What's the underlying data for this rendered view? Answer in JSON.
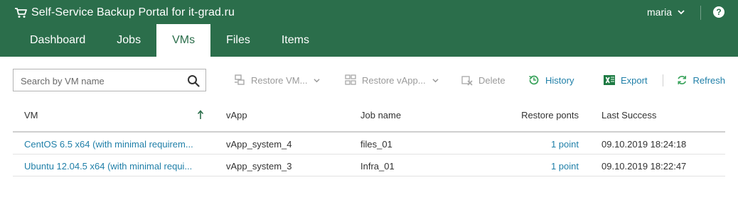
{
  "app": {
    "title": "Self-Service Backup Portal for it-grad.ru"
  },
  "user": {
    "name": "maria"
  },
  "tabs": [
    {
      "label": "Dashboard"
    },
    {
      "label": "Jobs"
    },
    {
      "label": "VMs"
    },
    {
      "label": "Files"
    },
    {
      "label": "Items"
    }
  ],
  "active_tab": "VMs",
  "search": {
    "placeholder": "Search by VM name",
    "value": ""
  },
  "toolbar": {
    "restore_vm": "Restore VM...",
    "restore_vapp": "Restore vApp...",
    "delete": "Delete",
    "history": "History",
    "export": "Export",
    "refresh": "Refresh"
  },
  "columns": {
    "vm": "VM",
    "vapp": "vApp",
    "job_name": "Job name",
    "restore_points": "Restore ponts",
    "last_success": "Last Success"
  },
  "sort": {
    "column": "VM",
    "direction": "ascending"
  },
  "rows": [
    {
      "vm": "CentOS 6.5 x64 (with minimal requirem...",
      "vapp": "vApp_system_4",
      "job": "files_01",
      "points": "1 point",
      "last_success": "09.10.2019 18:24:18"
    },
    {
      "vm": "Ubuntu 12.04.5 x64 (with minimal requi...",
      "vapp": "vApp_system_3",
      "job": "Infra_01",
      "points": "1 point",
      "last_success": "09.10.2019 18:22:47"
    }
  ],
  "colors": {
    "header_bg": "#2b6e4b",
    "link": "#1f7fa8",
    "disabled": "#9a9a9a"
  }
}
